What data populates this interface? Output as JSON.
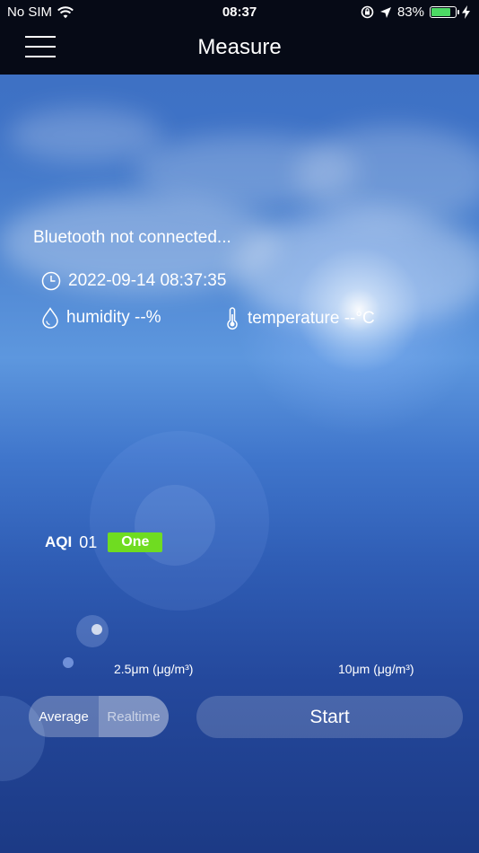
{
  "status_bar": {
    "carrier": "No SIM",
    "time": "08:37",
    "battery_percent": "83%",
    "battery_level": 0.83
  },
  "nav": {
    "title": "Measure"
  },
  "info": {
    "bluetooth_status": "Bluetooth not connected...",
    "datetime": "2022-09-14 08:37:35",
    "humidity": "humidity --%",
    "temperature": "temperature --°C"
  },
  "aqi": {
    "label": "AQI",
    "value": "01",
    "level": "One",
    "level_color": "#6fdc21"
  },
  "units": {
    "pm25": "2.5μm (μg/m³)",
    "pm10": "10μm (μg/m³)"
  },
  "mode_toggle": {
    "average": "Average",
    "realtime": "Realtime",
    "selected": "Average"
  },
  "actions": {
    "start": "Start"
  },
  "icons": {
    "menu": "hamburger-menu-icon",
    "clock": "clock-icon",
    "humidity": "water-drop-icon",
    "temperature": "thermometer-icon",
    "wifi": "wifi-icon",
    "location": "location-arrow-icon",
    "orientation_lock": "orientation-lock-icon",
    "battery": "battery-icon",
    "charging": "charging-bolt-icon"
  }
}
